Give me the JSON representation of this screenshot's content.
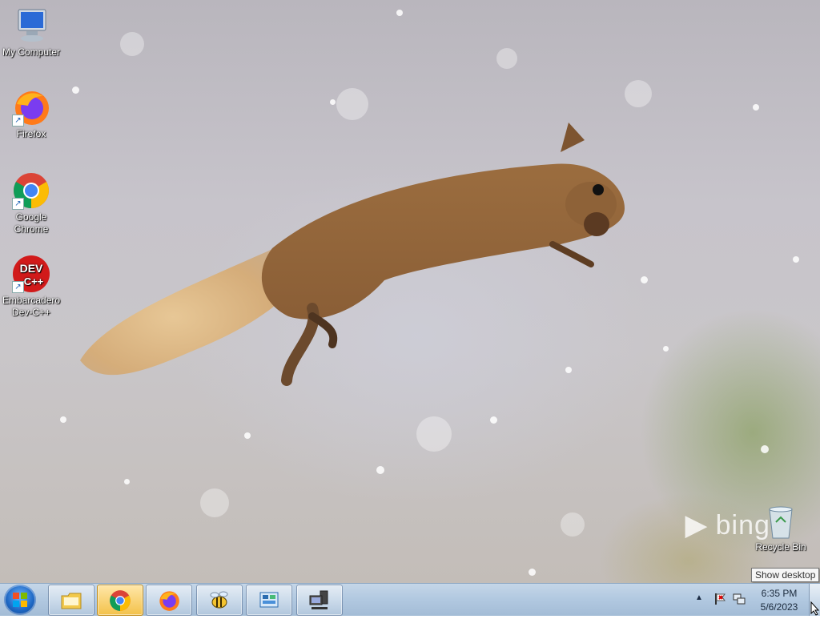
{
  "desktop": {
    "icons": [
      {
        "label": "My Computer"
      },
      {
        "label": "Firefox"
      },
      {
        "label": "Google Chrome"
      },
      {
        "label": "Embarcadero Dev-C++"
      },
      {
        "label": "Recycle Bin"
      }
    ],
    "wallpaper_brand": "bing",
    "tooltip": "Show desktop"
  },
  "taskbar": {
    "buttons": [
      {
        "name": "start-button",
        "icon": "windows-orb-icon"
      },
      {
        "name": "file-explorer",
        "icon": "folder-icon"
      },
      {
        "name": "chrome",
        "icon": "chrome-icon",
        "active": true
      },
      {
        "name": "firefox",
        "icon": "firefox-icon"
      },
      {
        "name": "bee-app",
        "icon": "bee-icon"
      },
      {
        "name": "control-panel",
        "icon": "control-panel-icon"
      },
      {
        "name": "network",
        "icon": "network-computer-icon"
      }
    ],
    "tray": {
      "chevron": "▲",
      "icons": [
        "action-center-flag-icon",
        "network-icon"
      ]
    },
    "clock": {
      "time": "6:35 PM",
      "date": "5/6/2023"
    }
  },
  "colors": {
    "taskbar": "#b1c8e0",
    "active_button": "#f3c24a"
  }
}
